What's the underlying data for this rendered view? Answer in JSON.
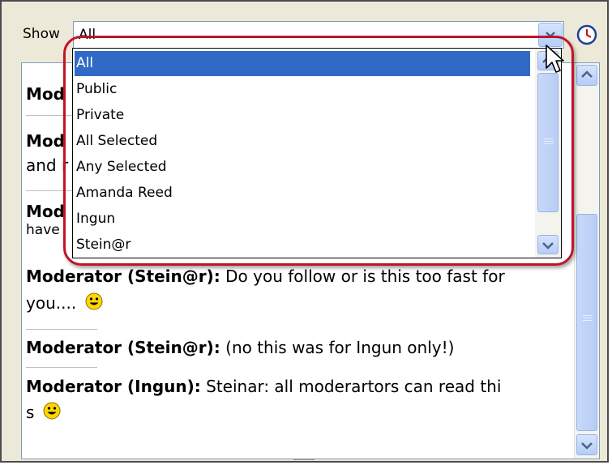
{
  "filter": {
    "label": "Show",
    "selected_value": "All",
    "options": [
      "All",
      "Public",
      "Private",
      "All Selected",
      "Any Selected",
      "Amanda Reed",
      "Ingun",
      "Stein@r"
    ]
  },
  "icons": {
    "dropdown_arrow": "chevron-down-icon",
    "clock": "clock-icon",
    "smiley": "smiley-icon",
    "cursor": "mouse-pointer-icon"
  },
  "chat": {
    "visible_fragments": [
      {
        "author": "Mod"
      },
      {
        "author": "Mod",
        "text": "and r"
      },
      {
        "author": "Mod",
        "text": "have"
      }
    ],
    "messages": [
      {
        "author": "Moderator (Stein@r):",
        "text": " Do you follow or is this too fast for",
        "text2": "you.... "
      },
      {
        "author": "Moderator (Stein@r):",
        "text": " (no  this was for Ingun only!)"
      },
      {
        "author": "Moderator (Ingun):",
        "text": " Steinar: all moderartors can read thi",
        "text2": "s "
      }
    ]
  },
  "colors": {
    "selection": "#316ac5",
    "highlight_ring": "#c0142a",
    "window_bg": "#ece9d8"
  }
}
